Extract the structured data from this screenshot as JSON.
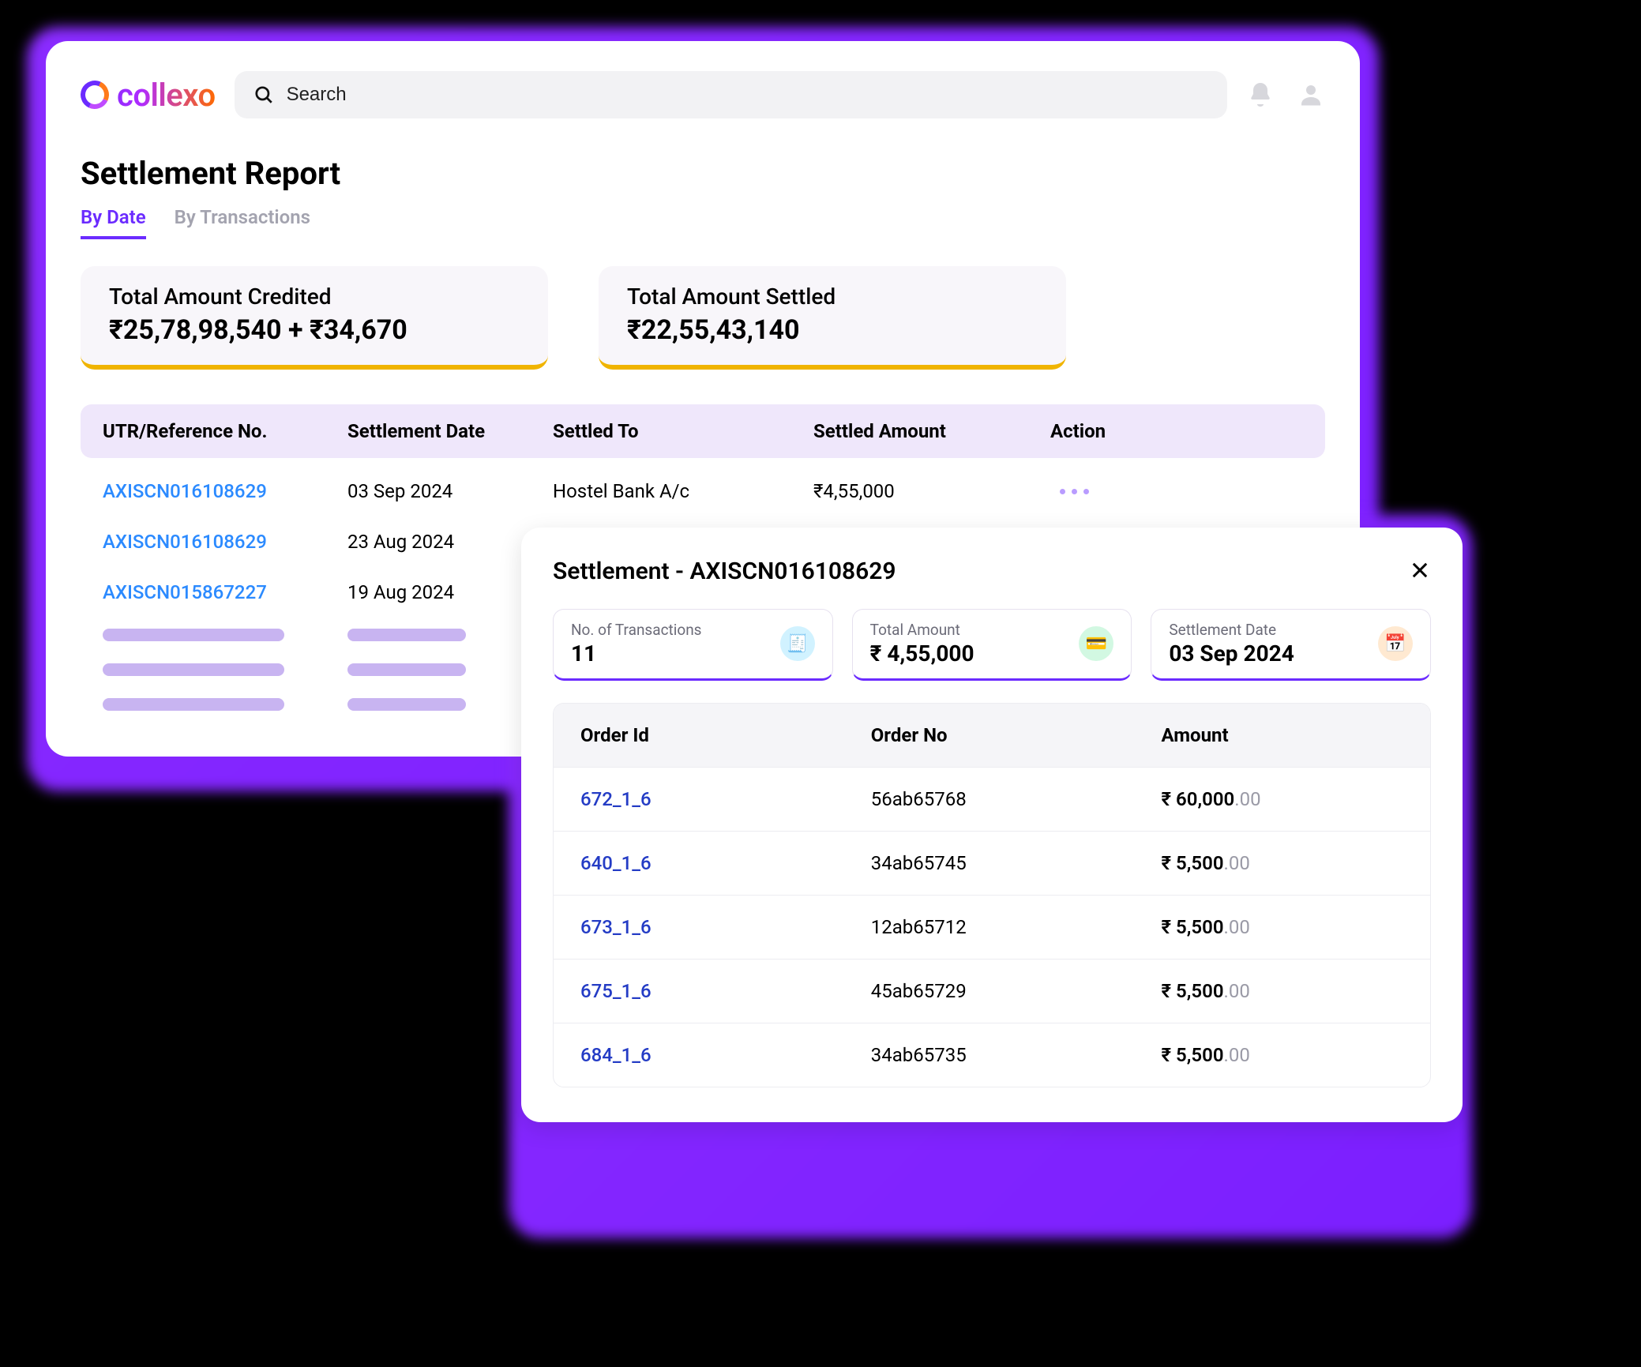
{
  "brand": "collexo",
  "search": {
    "placeholder": "Search"
  },
  "page_title": "Settlement Report",
  "tabs": [
    {
      "label": "By Date",
      "active": true
    },
    {
      "label": "By Transactions",
      "active": false
    }
  ],
  "stats": {
    "credited": {
      "label": "Total Amount Credited",
      "value": "₹25,78,98,540 + ₹34,670"
    },
    "settled": {
      "label": "Total Amount Settled",
      "value": "₹22,55,43,140"
    }
  },
  "table": {
    "headers": {
      "utr": "UTR/Reference No.",
      "date": "Settlement Date",
      "to": "Settled To",
      "amount": "Settled Amount",
      "action": "Action"
    },
    "rows": [
      {
        "utr": "AXISCN016108629",
        "date": "03 Sep 2024",
        "to": "Hostel Bank A/c",
        "amount": "₹4,55,000",
        "has_action": true
      },
      {
        "utr": "AXISCN016108629",
        "date": "23 Aug 2024"
      },
      {
        "utr": "AXISCN015867227",
        "date": "19 Aug 2024"
      }
    ]
  },
  "modal": {
    "title_prefix": "Settlement - ",
    "ref": "AXISCN016108629",
    "info": {
      "transactions": {
        "label": "No. of Transactions",
        "value": "11"
      },
      "total": {
        "label": "Total Amount",
        "value": "₹ 4,55,000"
      },
      "date": {
        "label": "Settlement Date",
        "value": "03 Sep 2024"
      }
    },
    "detail_headers": {
      "order_id": "Order Id",
      "order_no": "Order No",
      "amount": "Amount"
    },
    "details": [
      {
        "order_id": "672_1_6",
        "order_no": "56ab65768",
        "amount_main": "₹ 60,000",
        "amount_sub": ".00"
      },
      {
        "order_id": "640_1_6",
        "order_no": "34ab65745",
        "amount_main": "₹ 5,500",
        "amount_sub": ".00"
      },
      {
        "order_id": "673_1_6",
        "order_no": "12ab65712",
        "amount_main": "₹ 5,500",
        "amount_sub": ".00"
      },
      {
        "order_id": "675_1_6",
        "order_no": "45ab65729",
        "amount_main": "₹ 5,500",
        "amount_sub": ".00"
      },
      {
        "order_id": "684_1_6",
        "order_no": "34ab65735",
        "amount_main": "₹ 5,500",
        "amount_sub": ".00"
      }
    ]
  }
}
